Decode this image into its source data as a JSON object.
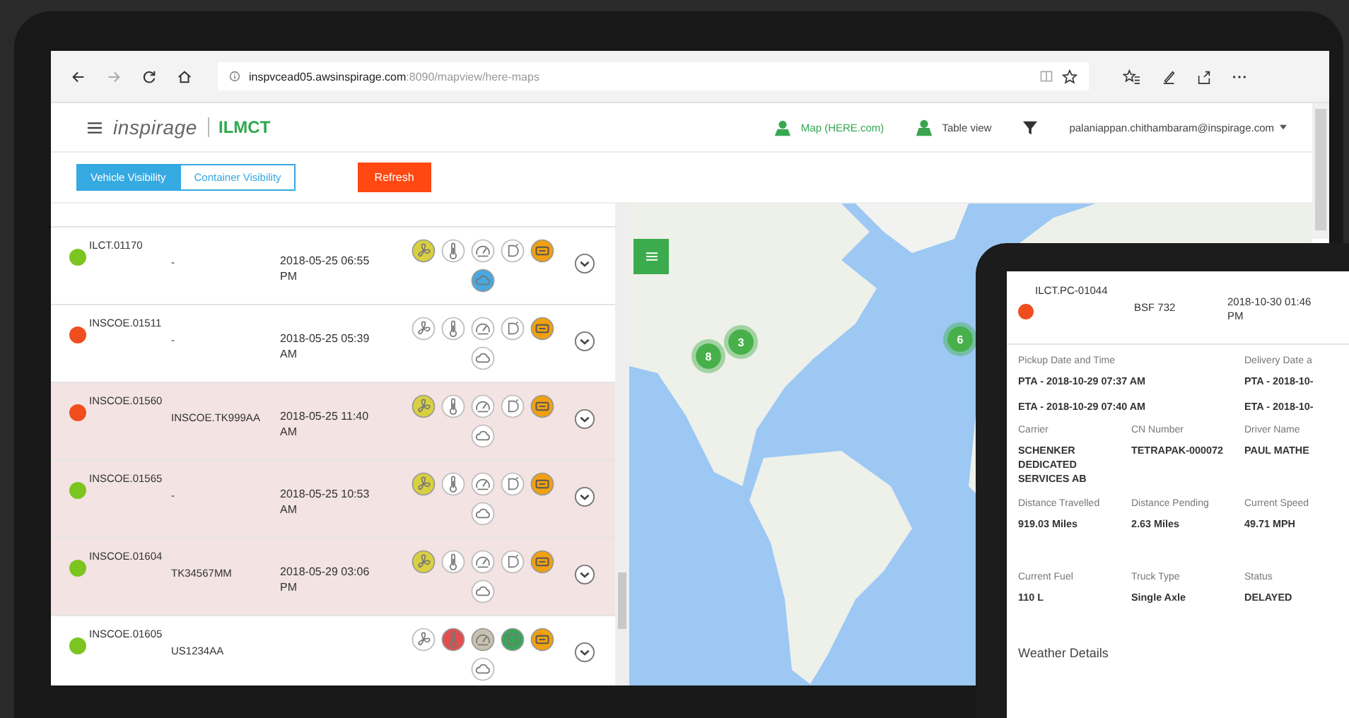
{
  "browser": {
    "url_host": "inspvcead05.awsinspirage.com",
    "url_path": ":8090/mapview/here-maps"
  },
  "header": {
    "logo": "inspirage",
    "app_name": "ILMCT",
    "nav": [
      {
        "label": "Map (HERE.com)",
        "selected": true
      },
      {
        "label": "Table view",
        "selected": false
      }
    ],
    "user": "palaniappan.chithambaram@inspirage.com"
  },
  "toggles": [
    {
      "label": "Vehicle Visibility",
      "selected": true
    },
    {
      "label": "Container Visibility",
      "selected": false
    }
  ],
  "refresh_button": "Refresh",
  "rows": [
    {
      "id": "ILCT.01170",
      "plate": "-",
      "datetime": "2018-05-25 06:55 PM",
      "color": "#7cc520",
      "highlighted": false,
      "sensors": [
        {
          "kind": "fan",
          "active": true,
          "color": "#d8d040"
        },
        {
          "kind": "thermometer",
          "active": false
        },
        {
          "kind": "gauge",
          "active": false
        },
        {
          "kind": "door",
          "active": false
        },
        {
          "kind": "battery",
          "active": true,
          "color": "#f0a010"
        },
        {
          "kind": "cloud",
          "active": true,
          "color": "#49a8e0"
        }
      ]
    },
    {
      "id": "INSCOE.01511",
      "plate": "-",
      "datetime": "2018-05-25 05:39 AM",
      "color": "#f04e1e",
      "highlighted": false,
      "sensors": [
        {
          "kind": "fan",
          "active": false
        },
        {
          "kind": "thermometer",
          "active": false
        },
        {
          "kind": "gauge",
          "active": false
        },
        {
          "kind": "door",
          "active": false
        },
        {
          "kind": "battery",
          "active": true,
          "color": "#f0a010"
        },
        {
          "kind": "cloud",
          "active": false
        }
      ]
    },
    {
      "id": "INSCOE.01560",
      "plate": "INSCOE.TK999AA",
      "datetime": "2018-05-25 11:40 AM",
      "color": "#f04e1e",
      "highlighted": true,
      "sensors": [
        {
          "kind": "fan",
          "active": true,
          "color": "#d8d040"
        },
        {
          "kind": "thermometer",
          "active": false
        },
        {
          "kind": "gauge",
          "active": false
        },
        {
          "kind": "door",
          "active": false
        },
        {
          "kind": "battery",
          "active": true,
          "color": "#f0a010"
        },
        {
          "kind": "cloud",
          "active": false
        }
      ]
    },
    {
      "id": "INSCOE.01565",
      "plate": "-",
      "datetime": "2018-05-25 10:53 AM",
      "color": "#7cc520",
      "highlighted": true,
      "sensors": [
        {
          "kind": "fan",
          "active": true,
          "color": "#d8d040"
        },
        {
          "kind": "thermometer",
          "active": false
        },
        {
          "kind": "gauge",
          "active": false
        },
        {
          "kind": "door",
          "active": false
        },
        {
          "kind": "battery",
          "active": true,
          "color": "#f0a010"
        },
        {
          "kind": "cloud",
          "active": false
        }
      ]
    },
    {
      "id": "INSCOE.01604",
      "plate": "TK34567MM",
      "datetime": "2018-05-29 03:06 PM",
      "color": "#7cc520",
      "highlighted": true,
      "sensors": [
        {
          "kind": "fan",
          "active": true,
          "color": "#d8d040"
        },
        {
          "kind": "thermometer",
          "active": false
        },
        {
          "kind": "gauge",
          "active": false
        },
        {
          "kind": "door",
          "active": false
        },
        {
          "kind": "battery",
          "active": true,
          "color": "#f0a010"
        },
        {
          "kind": "cloud",
          "active": false
        }
      ]
    },
    {
      "id": "INSCOE.01605",
      "plate": "US1234AA",
      "color": "#7cc520",
      "highlighted": false,
      "sensors": [
        {
          "kind": "fan",
          "active": false
        },
        {
          "kind": "thermometer",
          "active": true,
          "color": "#e05050"
        },
        {
          "kind": "gauge",
          "active": true,
          "color": "#c8c0b0"
        },
        {
          "kind": "door",
          "active": true,
          "color": "#3aa55a"
        },
        {
          "kind": "battery",
          "active": true,
          "color": "#f0a010"
        },
        {
          "kind": "cloud",
          "active": false
        }
      ]
    }
  ],
  "map": {
    "clusters": [
      {
        "count": "8"
      },
      {
        "count": "3"
      },
      {
        "count": "6"
      }
    ]
  },
  "tablet": {
    "record": {
      "id": "ILCT.PC-01044",
      "color": "#f04e1e",
      "plate": "BSF 732",
      "datetime": "2018-10-30 01:46 PM"
    },
    "dates": [
      {
        "label": "Pickup Date and Time",
        "lines": [
          "PTA - 2018-10-29 07:37 AM",
          "ETA - 2018-10-29 07:40 AM"
        ]
      },
      {
        "label": "Delivery Date a",
        "lines": [
          "PTA - 2018-10-",
          "ETA - 2018-10-"
        ]
      }
    ],
    "fields": [
      {
        "label": "Carrier",
        "value": "SCHENKER DEDICATED SERVICES AB"
      },
      {
        "label": "CN Number",
        "value": "TETRAPAK-000072"
      },
      {
        "label": "Driver Name",
        "value": "PAUL MATHE"
      },
      {
        "label": "Distance Travelled",
        "value": "919.03 Miles"
      },
      {
        "label": "Distance Pending",
        "value": "2.63 Miles"
      },
      {
        "label": "Current Speed",
        "value": "49.71 MPH"
      },
      {
        "label": "Current Fuel",
        "value": "110 L"
      },
      {
        "label": "Truck Type",
        "value": "Single Axle"
      },
      {
        "label": "Status",
        "value": "DELAYED"
      }
    ],
    "weather_heading": "Weather Details"
  }
}
